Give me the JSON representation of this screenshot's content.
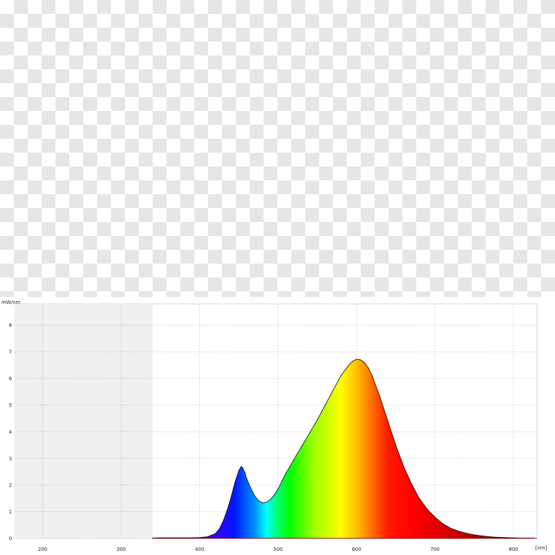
{
  "chart_data": {
    "type": "area",
    "title": "",
    "ylabel": "mW/nm",
    "xlabel": "[nm]",
    "xlim": [
      165,
      830
    ],
    "ylim": [
      0,
      8.8
    ],
    "x_ticks": [
      200,
      300,
      400,
      500,
      600,
      700,
      800
    ],
    "y_ticks": [
      0,
      1,
      2,
      3,
      4,
      5,
      6,
      7,
      8
    ],
    "grid": true,
    "shaded_region": [
      165,
      340
    ],
    "series": [
      {
        "fill": "visible-spectrum",
        "x": [
          340,
          350,
          360,
          370,
          380,
          390,
          400,
          410,
          420,
          425,
          430,
          435,
          440,
          445,
          450,
          453,
          455,
          458,
          460,
          465,
          470,
          475,
          480,
          485,
          490,
          495,
          500,
          505,
          510,
          515,
          520,
          530,
          540,
          550,
          560,
          570,
          580,
          590,
          595,
          600,
          605,
          610,
          615,
          620,
          630,
          640,
          650,
          660,
          670,
          680,
          690,
          700,
          710,
          720,
          730,
          740,
          750,
          760,
          770,
          780,
          790,
          800,
          810,
          820,
          826
        ],
        "y": [
          0.01,
          0.02,
          0.02,
          0.02,
          0.02,
          0.02,
          0.03,
          0.06,
          0.18,
          0.35,
          0.65,
          1.05,
          1.55,
          2.1,
          2.55,
          2.7,
          2.65,
          2.45,
          2.25,
          1.9,
          1.6,
          1.42,
          1.33,
          1.35,
          1.45,
          1.62,
          1.85,
          2.15,
          2.45,
          2.7,
          2.95,
          3.45,
          3.95,
          4.45,
          5.0,
          5.55,
          6.1,
          6.5,
          6.65,
          6.72,
          6.7,
          6.6,
          6.4,
          6.1,
          5.3,
          4.4,
          3.5,
          2.7,
          2.05,
          1.5,
          1.1,
          0.8,
          0.55,
          0.38,
          0.27,
          0.19,
          0.13,
          0.09,
          0.06,
          0.04,
          0.03,
          0.02,
          0.01,
          0.01,
          0.01
        ]
      }
    ]
  },
  "colors": {
    "plot_background": "#ffffff",
    "shaded_region": "#efefef",
    "grid": "#c8c8c8",
    "curve_outline": "#1a1a1a",
    "baseline": "#8b0000"
  }
}
